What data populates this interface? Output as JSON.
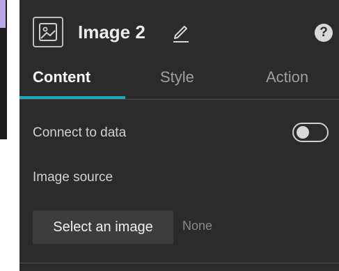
{
  "header": {
    "title": "Image 2",
    "icon": "image-icon",
    "edit_icon": "pencil-icon",
    "help_label": "?"
  },
  "tabs": [
    {
      "label": "Content",
      "active": true
    },
    {
      "label": "Style",
      "active": false
    },
    {
      "label": "Action",
      "active": false
    }
  ],
  "content": {
    "connect_label": "Connect to data",
    "connect_enabled": false,
    "source_label": "Image source",
    "select_button_label": "Select an image",
    "selected_value": "None"
  },
  "colors": {
    "panel_bg": "#2b2b2b",
    "accent": "#1fa5be",
    "button_bg": "#3d3d3d"
  }
}
